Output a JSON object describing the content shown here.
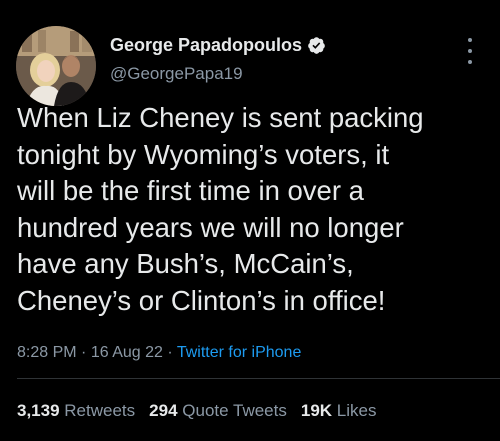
{
  "author": {
    "display_name": "George Papadopoulos",
    "handle": "@GeorgePapa19",
    "verified": true
  },
  "tweet": {
    "lines": [
      "When Liz Cheney is sent packing",
      "tonight by Wyoming’s voters, it",
      "will be the first time in over a",
      "hundred years we will no longer",
      "have any Bush’s, McCain’s,",
      "Cheney’s or Clinton’s in office!"
    ]
  },
  "meta": {
    "time": "8:28 PM",
    "separator": "·",
    "date": "16 Aug 22",
    "source": "Twitter for iPhone"
  },
  "stats": {
    "retweets_count": "3,139",
    "retweets_label": "Retweets",
    "quotes_count": "294",
    "quotes_label": "Quote Tweets",
    "likes_count": "19K",
    "likes_label": "Likes"
  },
  "colors": {
    "background": "#000000",
    "primary_text": "#e7e9ea",
    "secondary_text": "#8b98a5",
    "link": "#1d9bf0",
    "verified_badge": "#e7e9ea"
  },
  "icons": {
    "verified": "verified-badge-icon",
    "more": "more-options-icon"
  }
}
